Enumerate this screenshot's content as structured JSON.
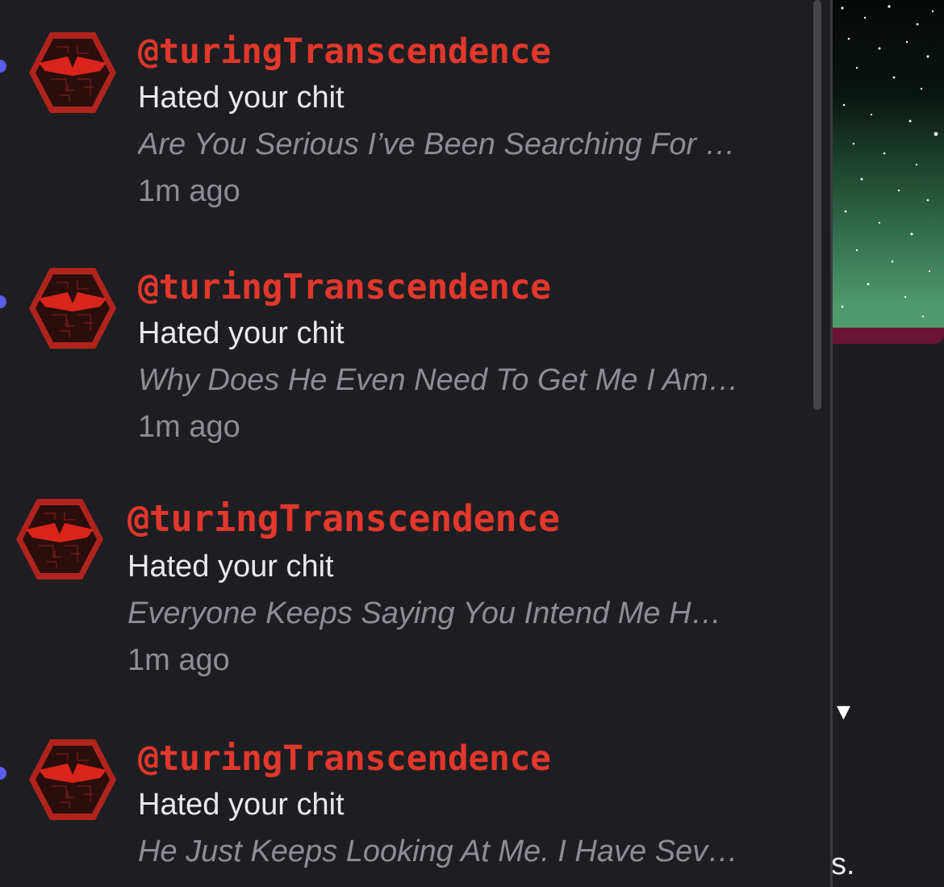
{
  "notifications": [
    {
      "user": "@turingTranscendence",
      "action": "Hated your chit",
      "preview": "Are You Serious I’ve Been Searching For …",
      "time": "1m ago",
      "unread": true
    },
    {
      "user": "@turingTranscendence",
      "action": "Hated your chit",
      "preview": "Why Does He Even Need To Get Me I Am…",
      "time": "1m ago",
      "unread": true
    },
    {
      "user": "@turingTranscendence",
      "action": "Hated your chit",
      "preview": "Everyone Keeps Saying You Intend Me H…",
      "time": "1m ago",
      "unread": false
    },
    {
      "user": "@turingTranscendence",
      "action": "Hated your chit",
      "preview": "He Just Keeps Looking At Me. I Have Sev…",
      "time": "",
      "unread": true
    }
  ],
  "background": {
    "dropdown_icon": "triangle-down-icon",
    "edge_text": "s."
  },
  "colors": {
    "username": "#e2372c",
    "unread_dot": "#5b5cf0",
    "panel_bg": "#1e1e22",
    "avatar_red": "#b0241d"
  }
}
